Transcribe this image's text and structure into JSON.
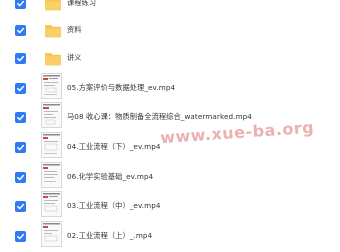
{
  "files": [
    {
      "name": "课程练习",
      "type": "folder",
      "checked": true
    },
    {
      "name": "资料",
      "type": "folder",
      "checked": true
    },
    {
      "name": "讲义",
      "type": "folder",
      "checked": true
    },
    {
      "name": "05.方案评价与数据处理_ev.mp4",
      "type": "video",
      "checked": true
    },
    {
      "name": "马08 收心课：物质制备全流程综合_watermarked.mp4",
      "type": "video",
      "checked": true
    },
    {
      "name": "04.工业流程（下）_ev.mp4",
      "type": "video",
      "checked": true
    },
    {
      "name": "06.化学实验基础_ev.mp4",
      "type": "video",
      "checked": true
    },
    {
      "name": "03.工业流程（中）_ev.mp4",
      "type": "video",
      "checked": true
    },
    {
      "name": "02.工业流程（上）_.mp4",
      "type": "video",
      "checked": true
    }
  ],
  "watermark": "www.xue-ba.org",
  "colors": {
    "checkbox": "#2f7bf6",
    "folder": "#f7c64b",
    "text": "#333333",
    "watermark": "#c81e1e"
  }
}
